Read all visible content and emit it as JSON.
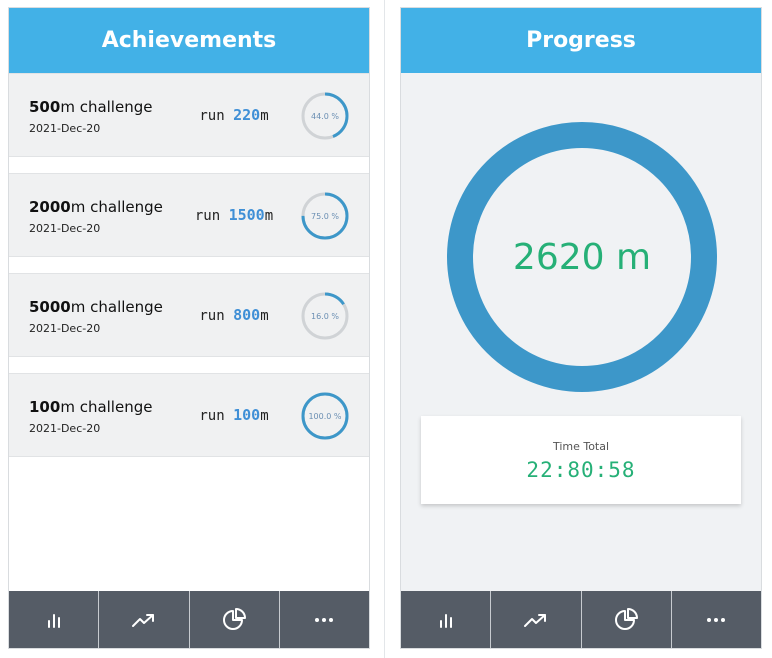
{
  "achievements": {
    "title": "Achievements",
    "items": [
      {
        "distance": "500",
        "suffix": "m challenge",
        "date": "2021-Dec-20",
        "run_prefix": "run ",
        "run_value": "220",
        "run_unit": "m",
        "percent_label": "44.0 %",
        "progress": 0.44
      },
      {
        "distance": "2000",
        "suffix": "m challenge",
        "date": "2021-Dec-20",
        "run_prefix": "run ",
        "run_value": "1500",
        "run_unit": "m",
        "percent_label": "75.0 %",
        "progress": 0.75
      },
      {
        "distance": "5000",
        "suffix": "m challenge",
        "date": "2021-Dec-20",
        "run_prefix": "run ",
        "run_value": "800",
        "run_unit": "m",
        "percent_label": "16.0 %",
        "progress": 0.16
      },
      {
        "distance": "100",
        "suffix": "m challenge",
        "date": "2021-Dec-20",
        "run_prefix": "run ",
        "run_value": "100",
        "run_unit": "m",
        "percent_label": "100.0 %",
        "progress": 1.0
      }
    ]
  },
  "progress": {
    "title": "Progress",
    "total_distance": "2620 m",
    "time_label": "Time Total",
    "time_value": "22:80:58"
  },
  "tabs": [
    {
      "icon": "bar-chart-icon"
    },
    {
      "icon": "trend-icon"
    },
    {
      "icon": "pie-chart-icon"
    },
    {
      "icon": "more-icon"
    }
  ],
  "colors": {
    "header": "#42b1e7",
    "ring": "#3d97c9",
    "ring_track": "#d0d3d6",
    "accent_green": "#26b077",
    "run_blue": "#3f8fd6",
    "tabbar": "#555c66"
  }
}
